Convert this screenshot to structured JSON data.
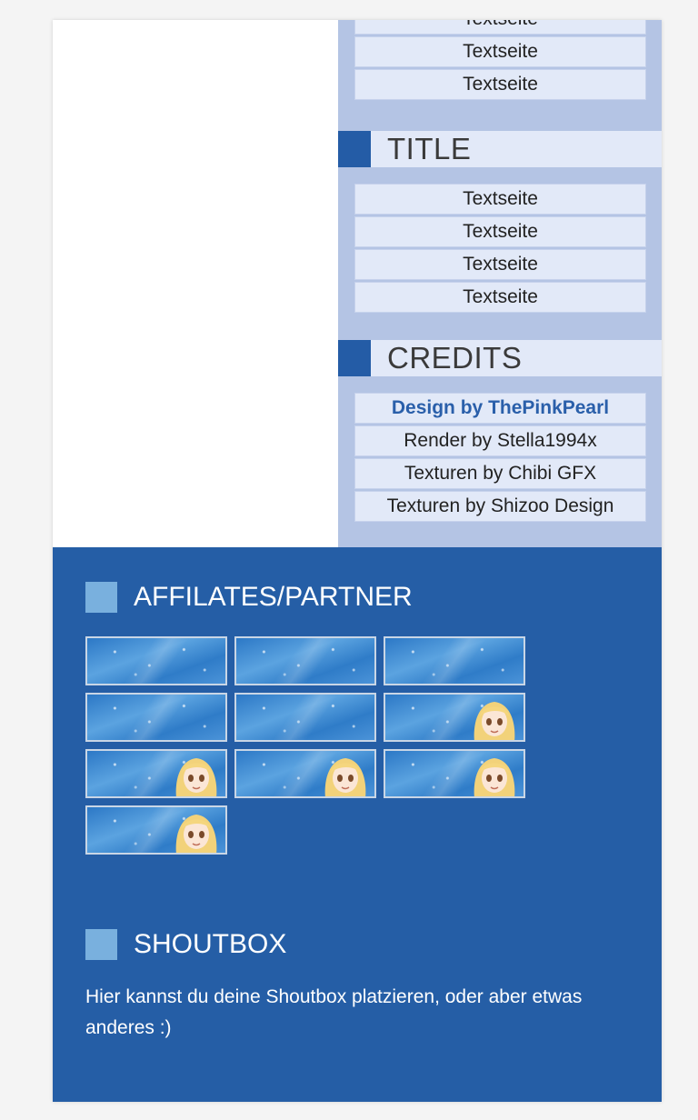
{
  "nav_top": {
    "items": [
      "Textseite",
      "Textseite",
      "Textseite"
    ]
  },
  "title_section": {
    "heading": "TITLE",
    "items": [
      "Textseite",
      "Textseite",
      "Textseite",
      "Textseite"
    ]
  },
  "credits_section": {
    "heading": "CREDITS",
    "items": [
      "Design by ThePinkPearl",
      "Render by Stella1994x",
      "Texturen by Chibi GFX",
      "Texturen by Shizoo Design"
    ]
  },
  "affiliates": {
    "heading": "AFFILATES/PARTNER",
    "banners": [
      {
        "has_character": false
      },
      {
        "has_character": false
      },
      {
        "has_character": false
      },
      {
        "has_character": false
      },
      {
        "has_character": false
      },
      {
        "has_character": true
      },
      {
        "has_character": true
      },
      {
        "has_character": true
      },
      {
        "has_character": true
      },
      {
        "has_character": true
      }
    ]
  },
  "shoutbox": {
    "heading": "SHOUTBOX",
    "text": "Hier kannst du deine Shoutbox platzieren, oder aber etwas anderes :)"
  },
  "colors": {
    "sidebar_bg": "#b4c4e4",
    "nav_item_bg": "#e2e9f8",
    "accent_blue": "#245ca6",
    "footer_bg": "#255ea6",
    "footer_square": "#79b0de",
    "credit_link": "#2a5faa"
  }
}
